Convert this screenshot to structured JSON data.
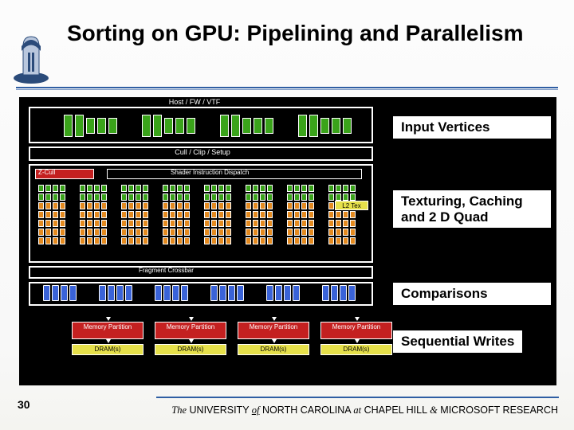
{
  "title": "Sorting on GPU: Pipelining and Parallelism",
  "page_number": "30",
  "footer": {
    "prefix_italic": "The",
    "univ": "UNIVERSITY",
    "of_italic": "of",
    "rest": "NORTH CAROLINA",
    "at_italic": "at",
    "place": "CHAPEL HILL",
    "amp": "&",
    "ms": "MICROSOFT RESEARCH"
  },
  "diagram": {
    "host_label": "Host / FW / VTF",
    "cull_label": "Cull / Clip / Setup",
    "zcull": "Z-Cull",
    "shader_dispatch": "Shader Instruction Dispatch",
    "l2_tex": "L2 Tex",
    "fragment_xbar": "Fragment Crossbar",
    "memory_partition": "Memory Partition",
    "dram": "DRAM(s)"
  },
  "callouts": {
    "c1": "Input Vertices",
    "c2": "Texturing, Caching and 2 D Quad",
    "c3": "Comparisons",
    "c4": "Sequential Writes"
  }
}
